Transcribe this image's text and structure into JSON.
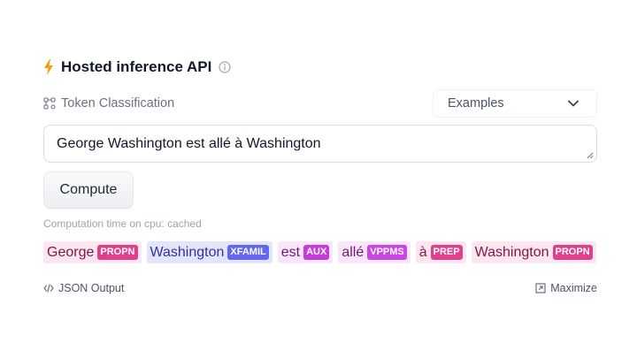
{
  "header": {
    "title": "Hosted inference API"
  },
  "task": {
    "label": "Token Classification"
  },
  "examples": {
    "label": "Examples"
  },
  "input": {
    "value": "George Washington est allé à Washington"
  },
  "compute": {
    "label": "Compute"
  },
  "computation_time": "Computation time on cpu: cached",
  "tokens": [
    {
      "word": "George",
      "label": "PROPN",
      "bg": "#fce7f0",
      "label_bg": "#e0408a",
      "color": "#831843"
    },
    {
      "word": "Washington",
      "label": "XFAMIL",
      "bg": "#e3e6fb",
      "label_bg": "#6366f1",
      "color": "#3730a3"
    },
    {
      "word": "est",
      "label": "AUX",
      "bg": "#f8e6fa",
      "label_bg": "#c73cd8",
      "color": "#701a75"
    },
    {
      "word": "allé",
      "label": "VPPMS",
      "bg": "#f8e6fa",
      "label_bg": "#c946e3",
      "color": "#701a75"
    },
    {
      "word": "à",
      "label": "PREP",
      "bg": "#fce7f0",
      "label_bg": "#e0408a",
      "color": "#831843"
    },
    {
      "word": "Washington",
      "label": "PROPN",
      "bg": "#fce7f0",
      "label_bg": "#e0408a",
      "color": "#831843"
    }
  ],
  "footer": {
    "json_output": "JSON Output",
    "maximize": "Maximize"
  },
  "colors": {
    "bolt": "#f59e0b",
    "muted": "#6b7280"
  }
}
